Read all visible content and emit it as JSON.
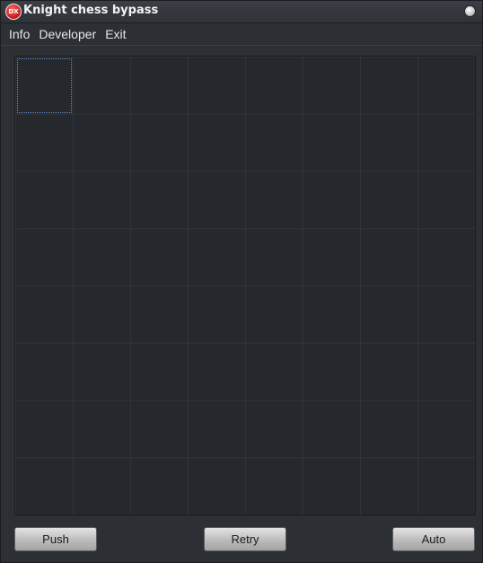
{
  "window": {
    "title": "Knight chess bypass",
    "logo_text": "DX"
  },
  "menu": {
    "items": [
      "Info",
      "Developer",
      "Exit"
    ]
  },
  "board": {
    "rows": 8,
    "cols": 8,
    "selected_cell": {
      "row": 0,
      "col": 0
    }
  },
  "buttons": {
    "push": "Push",
    "retry": "Retry",
    "auto": "Auto"
  },
  "colors": {
    "background": "#2c2f34",
    "board": "#25282c",
    "grid_line": "#30343a",
    "selection": "#5b8fc9"
  }
}
